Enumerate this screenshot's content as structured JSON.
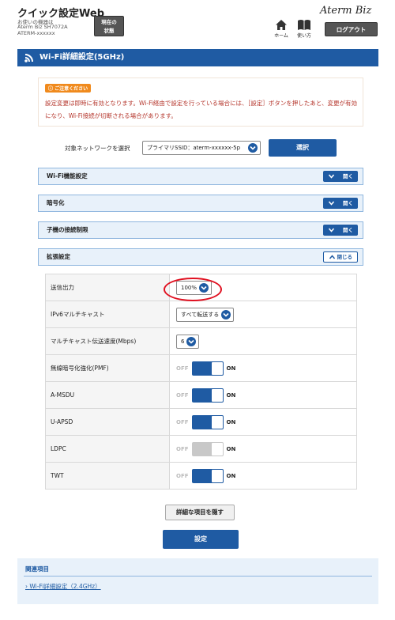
{
  "header": {
    "app_title": "クイック設定Web",
    "device_lines": [
      "お使いの機器は",
      "Aterm Biz SH7072A",
      "ATERM-xxxxxx"
    ],
    "status_button": [
      "現在の",
      "状態"
    ],
    "home_label": "ホーム",
    "manual_label": "使い方",
    "brand": "Aterm Biz",
    "logout_label": "ログアウト"
  },
  "page": {
    "title": "Wi-Fi詳細設定(5GHz)"
  },
  "notice": {
    "badge": "ご注意ください",
    "text": "設定変更は即時に有効となります。Wi-Fi経由で設定を行っている場合には、［設定］ボタンを押したあと、変更が有効になり、Wi-Fi接続が切断される場合があります。"
  },
  "network": {
    "label": "対象ネットワークを選択",
    "selected": "プライマリSSID：aterm-xxxxxx-5p",
    "button": "選択"
  },
  "sections": [
    {
      "title": "Wi-Fi機能設定",
      "toggle": "開く"
    },
    {
      "title": "暗号化",
      "toggle": "開く"
    },
    {
      "title": "子機の接続制限",
      "toggle": "開く"
    },
    {
      "title": "拡張設定",
      "toggle": "閉じる"
    }
  ],
  "settings": {
    "tx_power": {
      "label": "送信出力",
      "value": "100%"
    },
    "ipv6_multicast": {
      "label": "IPv6マルチキャスト",
      "value": "すべて転送する"
    },
    "multicast_rate": {
      "label": "マルチキャスト伝送速度(Mbps)",
      "value": "6"
    },
    "switch_off_label": "OFF",
    "switch_on_label": "ON",
    "pmf": {
      "label": "無線暗号化強化(PMF)",
      "on": true
    },
    "amsdu": {
      "label": "A-MSDU",
      "on": true
    },
    "uapsd": {
      "label": "U-APSD",
      "on": true
    },
    "ldpc": {
      "label": "LDPC",
      "on": true,
      "disabled": true
    },
    "twt": {
      "label": "TWT",
      "on": true
    }
  },
  "actions": {
    "hide_detail": "詳細な項目を隠す",
    "apply": "設定"
  },
  "related": {
    "title": "関連項目",
    "link": "Wi-Fi詳細設定（2.4GHz）"
  },
  "colors": {
    "primary": "#1f5ba3",
    "notice_badge": "#f08a1d",
    "notice_text": "#b5362c",
    "highlight": "#e01020"
  }
}
